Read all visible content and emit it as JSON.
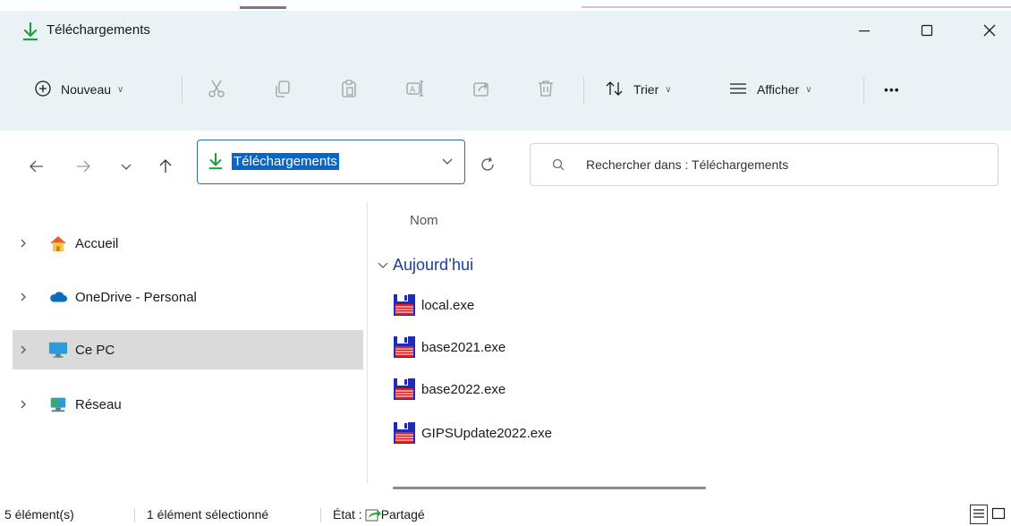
{
  "window": {
    "title": "Téléchargements",
    "controls": {
      "minimize": "minimize",
      "maximize": "maximize",
      "close": "close"
    }
  },
  "toolbar": {
    "new_label": "Nouveau",
    "sort_label": "Trier",
    "view_label": "Afficher",
    "more_label": "•••",
    "icons": [
      "cut-icon",
      "copy-icon",
      "paste-icon",
      "rename-icon",
      "share-icon",
      "delete-icon"
    ]
  },
  "address": {
    "path": "Téléchargements",
    "search_placeholder": "Rechercher dans : Téléchargements"
  },
  "sidebar": {
    "items": [
      {
        "label": "Accueil",
        "icon": "home-icon",
        "selected": false
      },
      {
        "label": "OneDrive - Personal",
        "icon": "cloud-icon",
        "selected": false
      },
      {
        "label": "Ce PC",
        "icon": "monitor-icon",
        "selected": true
      },
      {
        "label": "Réseau",
        "icon": "network-icon",
        "selected": false
      }
    ]
  },
  "content": {
    "column_name": "Nom",
    "group_label": "Aujourd’hui",
    "files": [
      {
        "name": "local.exe",
        "icon": "floppy-exe-icon"
      },
      {
        "name": "base2021.exe",
        "icon": "floppy-exe-icon"
      },
      {
        "name": "base2022.exe",
        "icon": "floppy-exe-icon"
      },
      {
        "name": "GIPSUpdate2022.exe",
        "icon": "floppy-exe-icon"
      }
    ]
  },
  "status": {
    "count": "5 élément(s)",
    "selected": "1 élément sélectionné",
    "state_label": "État :",
    "state_value": "Partagé"
  },
  "colors": {
    "accent": "#0a66c2",
    "chrome_bg": "#e9f3f6",
    "selected_bg": "#dadada",
    "group_header": "#1c3f94",
    "download_green": "#1e9e3a"
  }
}
